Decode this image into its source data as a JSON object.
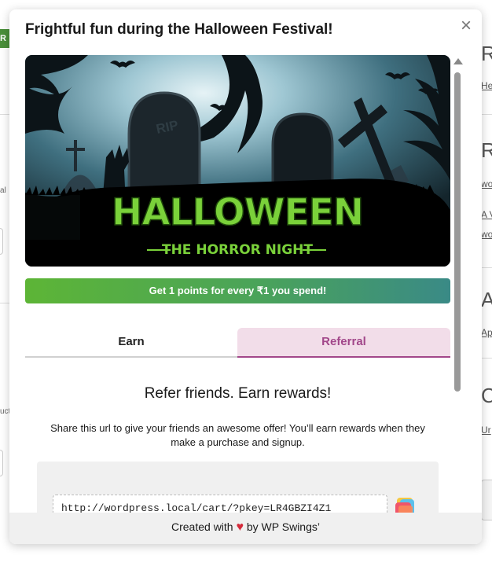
{
  "modal": {
    "title": "Frightful fun during the Halloween Festival!",
    "close_label": "×",
    "banner": {
      "headline": "HALLOWEEN",
      "subline": "THE HORROR NIGHT",
      "tombstone_text": "RIP"
    },
    "points_text": "Get 1 points for every ₹1 you spend!",
    "tabs": [
      {
        "label": "Earn",
        "active": false
      },
      {
        "label": "Referral",
        "active": true
      }
    ],
    "referral": {
      "heading": "Refer friends. Earn rewards!",
      "description": "Share this url to give your friends an awesome offer! You’ll earn rewards when they make a purchase and signup.",
      "url": "http://wordpress.local/cart/?pkey=LR4GBZI4Z1"
    },
    "footer": {
      "prefix": "Created with",
      "heart": "♥",
      "suffix": "by WP Swings’"
    }
  },
  "background": {
    "left_button": "R",
    "left_snippets": [
      "al",
      "uct"
    ],
    "right_headings": [
      "R",
      "R",
      "A",
      "C"
    ],
    "right_links": [
      "He",
      "wo",
      "A V",
      "wo",
      "Ap",
      "Ur"
    ]
  },
  "colors": {
    "accent_green": "#5db536",
    "accent_teal": "#3a8a86",
    "referral_purple": "#a2478a",
    "referral_tab_bg": "#f2dde9",
    "halloween_green": "#7ad13a"
  },
  "icons": {
    "close": "close-icon",
    "copy": "copy-icon",
    "heart": "heart-icon"
  }
}
